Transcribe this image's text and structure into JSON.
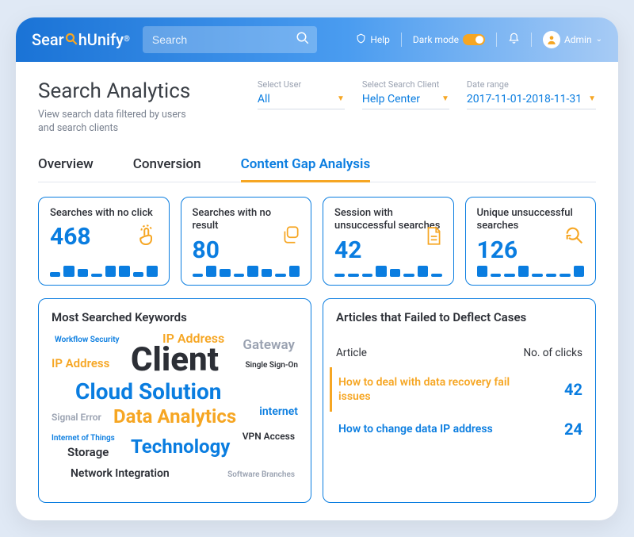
{
  "header": {
    "logo_prefix": "Sear",
    "logo_suffix": "hUnify",
    "search_placeholder": "Search",
    "help_label": "Help",
    "darkmode_label": "Dark mode",
    "admin_label": "Admin"
  },
  "page": {
    "title": "Search Analytics",
    "subtitle": "View search data filtered by users and search clients"
  },
  "filters": {
    "user": {
      "label": "Select User",
      "value": "All"
    },
    "client": {
      "label": "Select Search Client",
      "value": "Help Center"
    },
    "date": {
      "label": "Date range",
      "value": "2017-11-01-2018-11-31"
    }
  },
  "tabs": {
    "overview": "Overview",
    "conversion": "Conversion",
    "content_gap": "Content Gap Analysis"
  },
  "cards": {
    "no_click": {
      "label": "Searches with no click",
      "value": "468"
    },
    "no_result": {
      "label": "Searches with no result",
      "value": "80"
    },
    "session_unsuccess": {
      "label": "Session with unsuccessful searches",
      "value": "42"
    },
    "unique_unsuccess": {
      "label": "Unique unsuccessful searches",
      "value": "126"
    }
  },
  "keywords_panel": {
    "title": "Most Searched Keywords",
    "words": {
      "workflow_security": "Workflow Security",
      "ip_address_top": "IP Address",
      "gateway": "Gateway",
      "ip_address_left": "IP Address",
      "client": "Client",
      "sso": "Single Sign-On",
      "cloud_solution": "Cloud Solution",
      "internet": "internet",
      "signal_error": "Signal Error",
      "data_analytics": "Data Analytics",
      "iot": "Internet of Things",
      "vpn": "VPN Access",
      "storage": "Storage",
      "technology": "Technology",
      "network": "Network Integration",
      "branches": "Software Branches"
    }
  },
  "articles_panel": {
    "title": "Articles that Failed to Deflect Cases",
    "col_article": "Article",
    "col_clicks": "No. of clicks",
    "rows": [
      {
        "title": "How to deal with data recovery fail issues",
        "clicks": "42",
        "active": true
      },
      {
        "title": "How to change data IP address",
        "clicks": "24",
        "active": false
      }
    ]
  },
  "chart_data": [
    {
      "type": "bar",
      "card": "no_click",
      "values": [
        6,
        14,
        10,
        4,
        14,
        14,
        6,
        14
      ],
      "ylim": [
        0,
        18
      ]
    },
    {
      "type": "bar",
      "card": "no_result",
      "values": [
        4,
        14,
        10,
        4,
        14,
        10,
        4,
        14
      ],
      "ylim": [
        0,
        18
      ]
    },
    {
      "type": "bar",
      "card": "session_unsuccess",
      "values": [
        4,
        4,
        4,
        14,
        10,
        4,
        14,
        4
      ],
      "ylim": [
        0,
        18
      ]
    },
    {
      "type": "bar",
      "card": "unique_unsuccess",
      "values": [
        14,
        4,
        4,
        14,
        4,
        4,
        4,
        14
      ],
      "ylim": [
        0,
        18
      ]
    }
  ]
}
